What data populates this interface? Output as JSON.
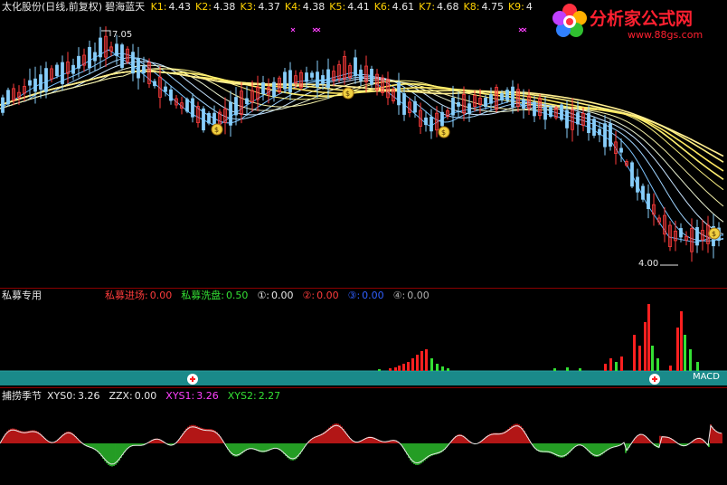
{
  "main": {
    "title": "太化股份(日线,前复权)",
    "indicator": "碧海蓝天",
    "k_values": [
      {
        "label": "K1:",
        "value": "4.43"
      },
      {
        "label": "K2:",
        "value": "4.38"
      },
      {
        "label": "K3:",
        "value": "4.37"
      },
      {
        "label": "K4:",
        "value": "4.38"
      },
      {
        "label": "K5:",
        "value": "4.41"
      },
      {
        "label": "K6:",
        "value": "4.61"
      },
      {
        "label": "K7:",
        "value": "4.68"
      },
      {
        "label": "K8:",
        "value": "4.75"
      },
      {
        "label": "K9:",
        "value": "4"
      }
    ],
    "high_label": "7.05",
    "low_label": "4.00",
    "logo_main": "分析家公式网",
    "logo_url": "www.88gs.com",
    "logo_icon": "flower-logo-icon",
    "buy_icon": "money-bag-icon",
    "marker_icon": "x-marker-icon"
  },
  "panel2": {
    "title": "私募专用",
    "items": [
      {
        "label": "私募进场:",
        "value": "0.00",
        "color": "#ff3c3c"
      },
      {
        "label": "私募洗盘:",
        "value": "0.50",
        "color": "#34e034"
      },
      {
        "label": "①:",
        "value": "0.00",
        "color": "#e8e8e8"
      },
      {
        "label": "②:",
        "value": "0.00",
        "color": "#ff3c3c"
      },
      {
        "label": "③:",
        "value": "0.00",
        "color": "#3060ff"
      },
      {
        "label": "④:",
        "value": "0.00",
        "color": "#b0b0b0"
      }
    ],
    "macd_label": "MACD",
    "band_color": "#1a8a8a"
  },
  "panel3": {
    "title": "捕捞季节",
    "items": [
      {
        "label": "XYS0:",
        "value": "3.26",
        "color": "#e8e8e8"
      },
      {
        "label": "ZZX:",
        "value": "0.00",
        "color": "#e8e8e8"
      },
      {
        "label": "XYS1:",
        "value": "3.26",
        "color": "#ff40ff"
      },
      {
        "label": "XYS2:",
        "value": "2.27",
        "color": "#34e034"
      }
    ]
  },
  "colors": {
    "up": "#ff3c3c",
    "down": "#34e034",
    "ribbon_fast": "#87cefa",
    "ribbon_slow": "#ffff66",
    "separator": "#8a0000"
  }
}
